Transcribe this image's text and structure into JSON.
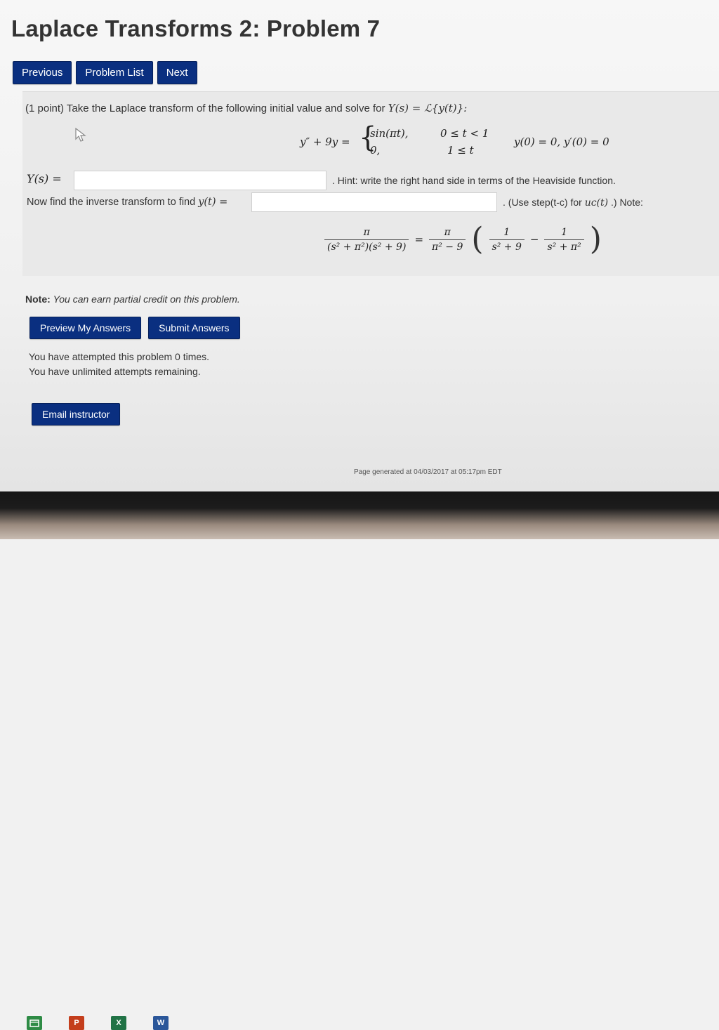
{
  "page": {
    "title": "Laplace Transforms 2: Problem 7"
  },
  "nav": {
    "previous": "Previous",
    "problem_list": "Problem List",
    "next": "Next"
  },
  "problem": {
    "intro": "(1 point) Take the Laplace transform of the following initial value and solve for",
    "intro_math": "Y(s) = ℒ{y(t)}:",
    "ode_lhs": "y″ + 9y =",
    "case1_expr": "sin(πt),",
    "case1_cond": "0 ≤ t < 1",
    "case2_expr": "0,",
    "case2_cond": "1 ≤ t",
    "initial_conditions": "y(0) = 0,  y′(0) = 0",
    "ys_label": "Y(s) =",
    "ys_value": "",
    "hint": ". Hint: write the right hand side in terms of the Heaviside function.",
    "inverse_label_text": "Now find the inverse transform to find",
    "inverse_label_math": "y(t) =",
    "inverse_value": "",
    "inverse_note_pre": ". (Use step(t-c) for",
    "inverse_note_math": "uᴄ(t)",
    "inverse_note_post": ".) Note:",
    "identity": {
      "lhs_num": "π",
      "lhs_den": "(s² + π²)(s² + 9)",
      "equals": "=",
      "coef_num": "π",
      "coef_den": "π² − 9",
      "t1_num": "1",
      "t1_den": "s² + 9",
      "minus": "−",
      "t2_num": "1",
      "t2_den": "s² + π²"
    }
  },
  "note": {
    "label": "Note:",
    "text": "You can earn partial credit on this problem."
  },
  "actions": {
    "preview": "Preview My Answers",
    "submit": "Submit Answers"
  },
  "attempts": {
    "line1": "You have attempted this problem 0 times.",
    "line2": "You have unlimited attempts remaining."
  },
  "email": {
    "label": "Email instructor"
  },
  "footer": {
    "generated": "Page generated at 04/03/2017 at 05:17pm EDT"
  },
  "taskbar": {
    "ppt_letter": "P",
    "excel_letter": "X",
    "word_letter": "W"
  }
}
